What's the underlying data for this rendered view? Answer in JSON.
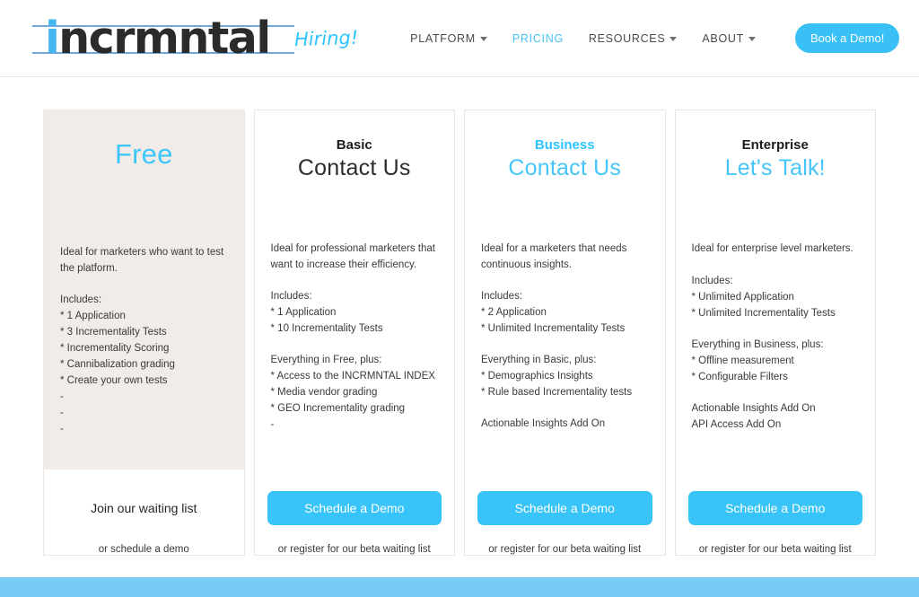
{
  "header": {
    "logo_text": "incrmntal",
    "logo_accent_letter": "i",
    "hiring_label": "Hiring!",
    "nav": [
      {
        "label": "PLATFORM",
        "has_caret": true,
        "active": false
      },
      {
        "label": "PRICING",
        "has_caret": false,
        "active": true
      },
      {
        "label": "RESOURCES",
        "has_caret": true,
        "active": false
      },
      {
        "label": "ABOUT",
        "has_caret": true,
        "active": false
      }
    ],
    "demo_button": "Book a Demo!"
  },
  "colors": {
    "accent_cyan": "#38c4f8",
    "logo_blue": "#45b6f0",
    "card_tint": "#f1ece8",
    "footer_blue": "#77ccf7"
  },
  "plans": [
    {
      "name": "",
      "price": "Free",
      "description": "Ideal for marketers who want to test the platform.",
      "includes_title": "Includes:",
      "includes": [
        "* 1 Application",
        "* 3 Incrementality Tests",
        "* Incrementality Scoring",
        "* Cannibalization grading",
        "* Create your own tests",
        "-",
        "-",
        "-"
      ],
      "extra_title": "",
      "extra": [],
      "addons": [],
      "cta": "Join our waiting list",
      "sub_cta": "or schedule a demo"
    },
    {
      "name": "Basic",
      "price": "Contact Us",
      "description": "Ideal for professional marketers that want to increase their efficiency.",
      "includes_title": "Includes:",
      "includes": [
        "* 1 Application",
        "* 10 Incrementality Tests"
      ],
      "extra_title": "Everything in Free, plus:",
      "extra": [
        "* Access to the INCRMNTAL INDEX",
        "* Media vendor grading",
        "* GEO Incrementality grading",
        "-"
      ],
      "addons": [],
      "cta": "Schedule a Demo",
      "sub_cta": "or register for our beta waiting list"
    },
    {
      "name": "Business",
      "price": "Contact Us",
      "description": "Ideal for a marketers that needs continuous insights.",
      "includes_title": "Includes:",
      "includes": [
        "* 2 Application",
        "* Unlimited Incrementality Tests"
      ],
      "extra_title": "Everything in Basic, plus:",
      "extra": [
        "* Demographics Insights",
        "* Rule based Incrementality tests"
      ],
      "addons": [
        "Actionable Insights Add On"
      ],
      "cta": "Schedule a Demo",
      "sub_cta": "or register for our beta waiting list"
    },
    {
      "name": "Enterprise",
      "price": "Let's Talk!",
      "description": "Ideal for enterprise level marketers.",
      "includes_title": "Includes:",
      "includes": [
        "* Unlimited Application",
        "* Unlimited Incrementality Tests"
      ],
      "extra_title": "Everything in Business, plus:",
      "extra": [
        "* Offline measurement",
        "* Configurable Filters"
      ],
      "addons": [
        "Actionable Insights Add On",
        "API Access Add On"
      ],
      "cta": "Schedule a Demo",
      "sub_cta": "or register for our beta waiting list"
    }
  ]
}
